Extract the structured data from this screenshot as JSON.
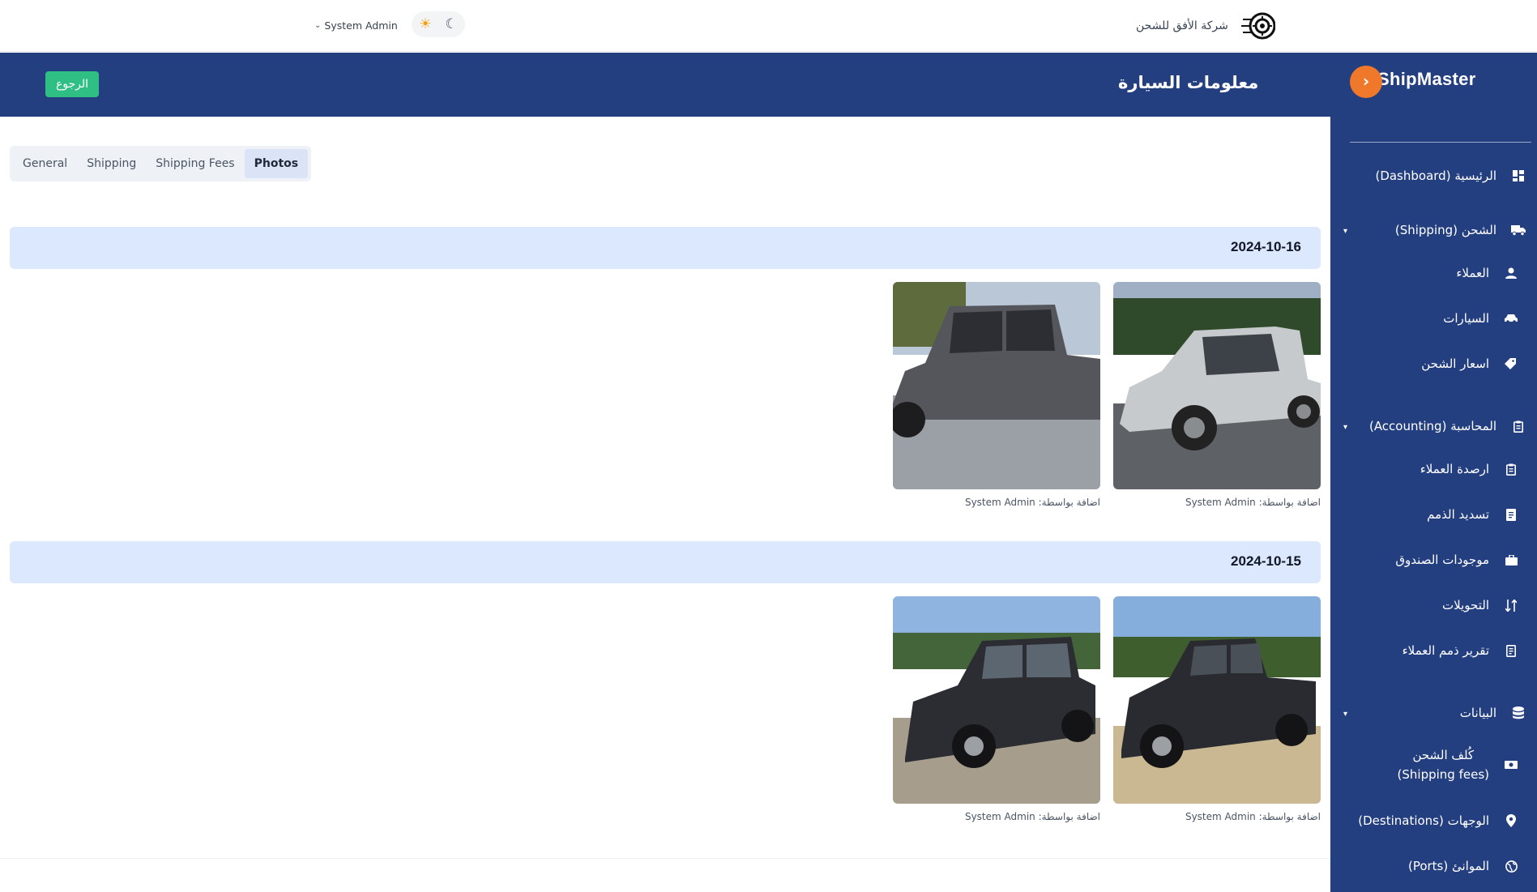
{
  "topbar": {
    "company_name": "شركة الأفق للشحن",
    "user_name": "System Admin",
    "sun_icon": "sun-icon",
    "moon_icon": "moon-icon"
  },
  "header": {
    "brand": "ShipMaster",
    "page_title": "معلومات السيارة",
    "back_label": "الرجوع"
  },
  "sidebar": {
    "dashboard": "الرئيسية (Dashboard)",
    "shipping": "الشحن (Shipping)",
    "customers": "العملاء",
    "cars": "السيارات",
    "shipping_prices": "اسعار الشحن",
    "accounting": "المحاسبة (Accounting)",
    "customer_balances": "ارصدة العملاء",
    "debt_payment": "تسديد الذمم",
    "cash_box": "موجودات الصندوق",
    "transfers": "التحويلات",
    "customer_debts_report": "تقرير ذمم العملاء",
    "data": "البيانات",
    "shipping_fees_line1": "كُلف الشحن",
    "shipping_fees_line2": "(Shipping fees)",
    "destinations": "الوجهات (Destinations)",
    "ports": "الموانئ (Ports)"
  },
  "tabs": [
    {
      "label": "General"
    },
    {
      "label": "Shipping"
    },
    {
      "label": "Shipping Fees"
    },
    {
      "label": "Photos",
      "active": true
    }
  ],
  "photo_groups": [
    {
      "date": "2024-10-16",
      "photos": [
        {
          "caption": "اضافة بواسطة: System Admin"
        },
        {
          "caption": "اضافة بواسطة: System Admin"
        }
      ]
    },
    {
      "date": "2024-10-15",
      "photos": [
        {
          "caption": "اضافة بواسطة: System Admin"
        },
        {
          "caption": "اضافة بواسطة: System Admin"
        }
      ]
    }
  ],
  "colors": {
    "primary": "#243f80",
    "accent_orange": "#f0782a",
    "back_green": "#2fbf85",
    "date_bar": "#dce8fd"
  }
}
